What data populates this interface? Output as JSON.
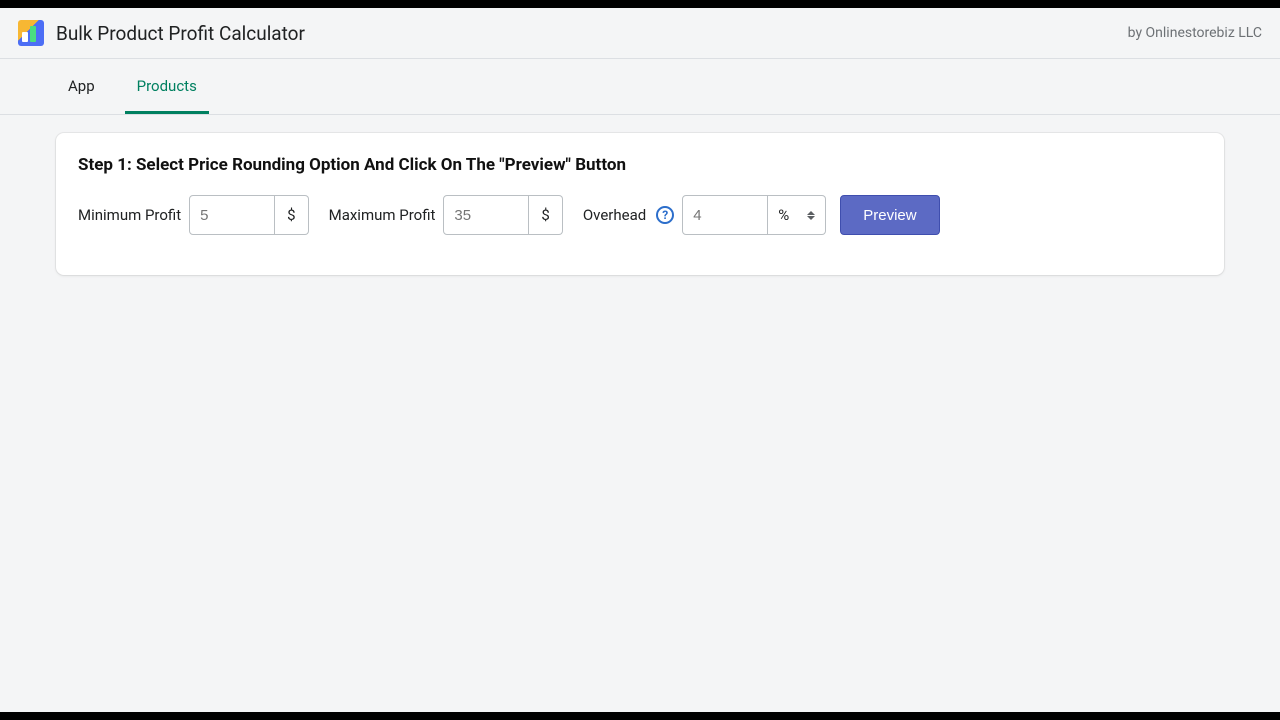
{
  "header": {
    "title": "Bulk Product Profit Calculator",
    "byline": "by Onlinestorebiz LLC"
  },
  "tabs": {
    "app": "App",
    "products": "Products"
  },
  "card": {
    "step_title": "Step 1: Select Price Rounding Option And Click On The \"Preview\" Button",
    "min_profit_label": "Minimum Profit",
    "min_profit_placeholder": "5",
    "min_profit_suffix": "$",
    "max_profit_label": "Maximum Profit",
    "max_profit_placeholder": "35",
    "max_profit_suffix": "$",
    "overhead_label": "Overhead",
    "overhead_placeholder": "4",
    "overhead_unit": "%",
    "help_symbol": "?",
    "preview_button": "Preview"
  }
}
